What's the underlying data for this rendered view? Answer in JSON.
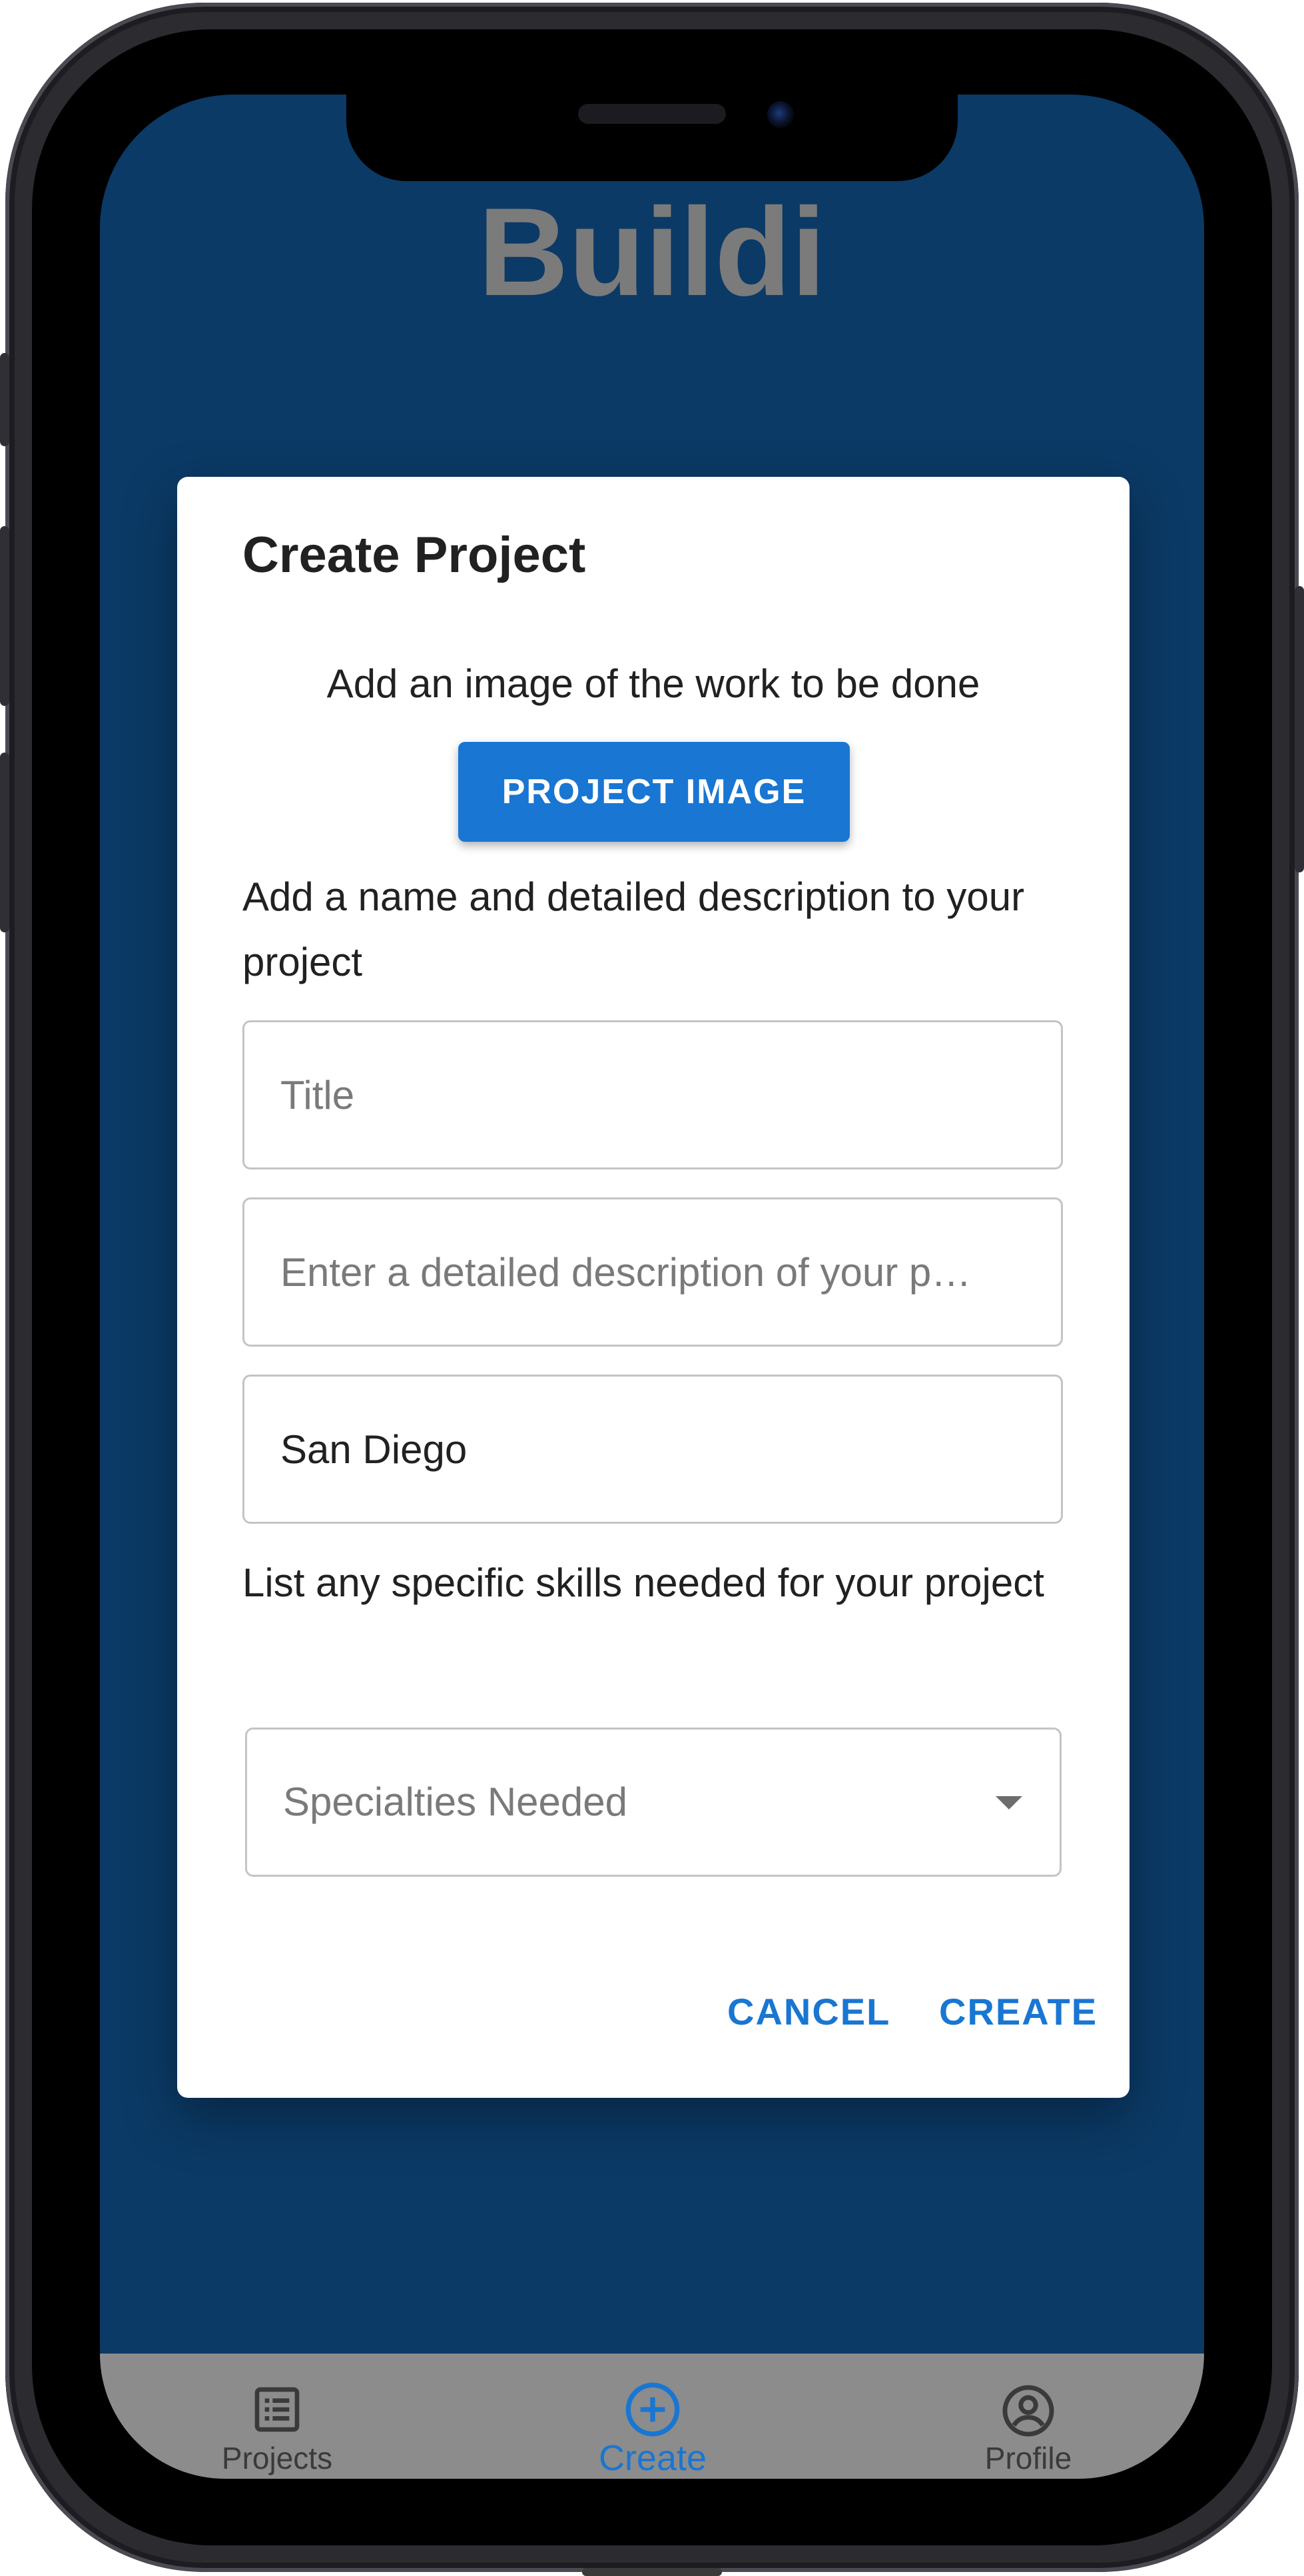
{
  "app": {
    "title": "Buildi"
  },
  "dialog": {
    "title": "Create Project",
    "image_prompt": "Add an image of the work to be done",
    "image_button_label": "PROJECT IMAGE",
    "name_prompt": "Add a name and detailed description to your project",
    "title_field": {
      "placeholder": "Title",
      "value": ""
    },
    "description_field": {
      "placeholder": "Enter a detailed description of your p…",
      "value": ""
    },
    "location_field": {
      "placeholder": "",
      "value": "San Diego"
    },
    "skills_prompt": "List any specific skills needed for your project",
    "specialties_select": {
      "label": "Specialties Needed"
    },
    "cancel_label": "CANCEL",
    "create_label": "CREATE"
  },
  "bottom_nav": {
    "items": [
      {
        "label": "Projects",
        "icon": "list-icon",
        "active": false
      },
      {
        "label": "Create",
        "icon": "add-circle-icon",
        "active": true
      },
      {
        "label": "Profile",
        "icon": "account-circle-icon",
        "active": false
      }
    ]
  },
  "colors": {
    "background": "#0b3a66",
    "primary": "#1976d2",
    "nav_bg": "#8c8c8c",
    "title_gray": "#7b7b7b"
  }
}
